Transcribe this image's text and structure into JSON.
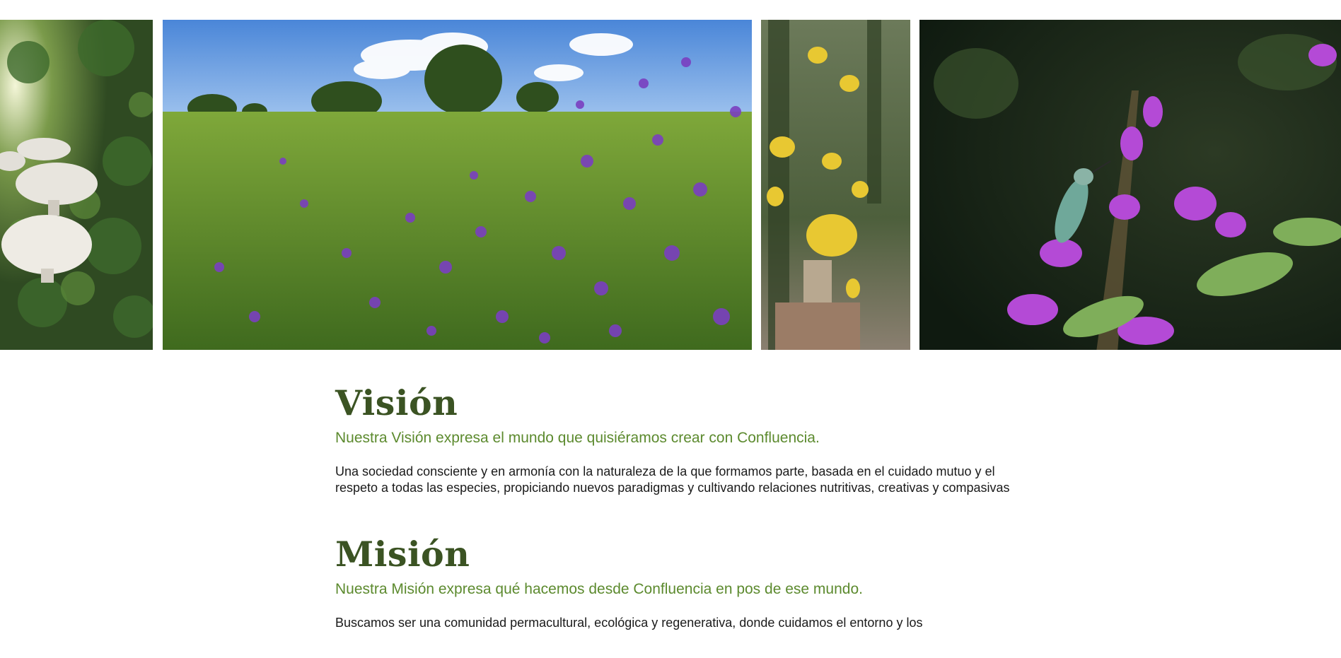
{
  "gallery": {
    "photos": [
      {
        "name": "mushrooms-photo",
        "subject": "white mushrooms among clover"
      },
      {
        "name": "meadow-photo",
        "subject": "purple wildflower meadow under blue sky"
      },
      {
        "name": "orchid-photo",
        "subject": "yellow orchid flowers"
      },
      {
        "name": "hummingbird-photo",
        "subject": "hummingbird at purple salvia flowers"
      }
    ]
  },
  "vision": {
    "title": "Visión",
    "subtitle": "Nuestra Visión expresa el mundo que quisiéramos crear con Confluencia.",
    "body": "Una sociedad consciente y en armonía con la naturaleza de la que formamos parte, basada en el cuidado mutuo y el respeto a todas las especies, propiciando nuevos paradigmas y cultivando relaciones nutritivas, creativas y compasivas"
  },
  "mission": {
    "title": "Misión",
    "subtitle": "Nuestra Misión expresa qué hacemos desde Confluencia en pos de ese mundo.",
    "body": "Buscamos ser una comunidad permacultural, ecológica y regenerativa, donde cuidamos el entorno y los"
  },
  "colors": {
    "title": "#3b5323",
    "subtitle": "#5c8a2e",
    "body": "#1a1a1a"
  }
}
